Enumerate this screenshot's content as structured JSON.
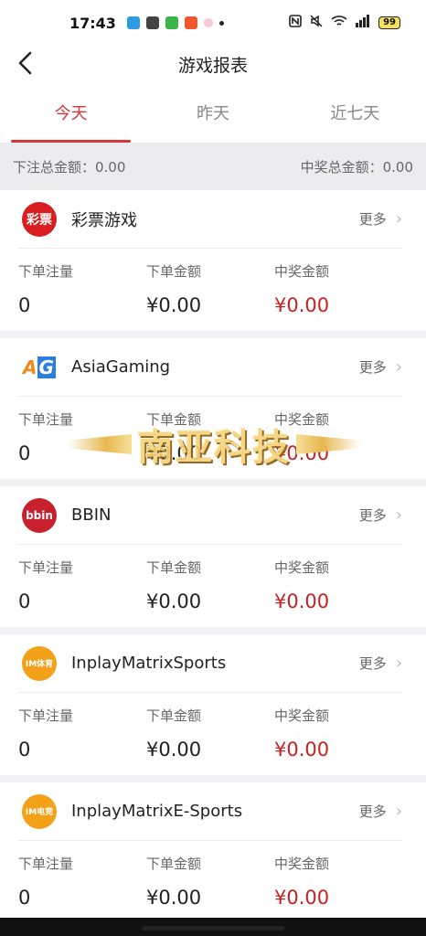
{
  "status_bar": {
    "time": "17:43",
    "battery": "99"
  },
  "nav": {
    "title": "游戏报表"
  },
  "tabs": [
    {
      "label": "今天",
      "active": true
    },
    {
      "label": "昨天",
      "active": false
    },
    {
      "label": "近七天",
      "active": false
    }
  ],
  "summary": {
    "bet_total_label": "下注总金额：0.00",
    "win_total_label": "中奖总金额：0.00"
  },
  "stat_labels": {
    "count": "下单注量",
    "amount": "下单金额",
    "win": "中奖金额"
  },
  "more_label": "更多",
  "games": [
    {
      "name": "彩票游戏",
      "logo_text": "彩票",
      "count": "0",
      "amount": "¥0.00",
      "win": "¥0.00"
    },
    {
      "name": "AsiaGaming",
      "logo_text": "AG",
      "count": "0",
      "amount": "¥0.00",
      "win": "¥0.00"
    },
    {
      "name": "BBIN",
      "logo_text": "bbin",
      "count": "0",
      "amount": "¥0.00",
      "win": "¥0.00"
    },
    {
      "name": "InplayMatrixSports",
      "logo_text": "IM体育",
      "count": "0",
      "amount": "¥0.00",
      "win": "¥0.00"
    },
    {
      "name": "InplayMatrixE-Sports",
      "logo_text": "IM电竞",
      "count": "0",
      "amount": "¥0.00",
      "win": "¥0.00"
    }
  ],
  "watermark": {
    "text": "南亚科技"
  },
  "colors": {
    "accent": "#d8343a",
    "win_red": "#cc1f1f"
  }
}
